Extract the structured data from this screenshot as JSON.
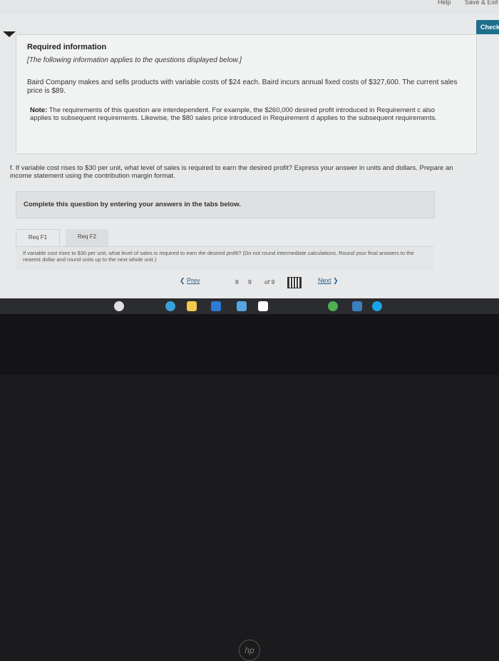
{
  "header": {
    "help": "Help",
    "save_exit": "Save & Exit",
    "check": "Check"
  },
  "required": {
    "title": "Required information",
    "subtitle": "[The following information applies to the questions displayed below.]",
    "body": "Baird Company makes and sells products with variable costs of $24 each. Baird incurs annual fixed costs of $327,600. The current sales price is $89.",
    "note_label": "Note:",
    "note": " The requirements of this question are interdependent. For example, the $260,000 desired profit introduced in Requirement c also applies to subsequent requirements. Likewise, the $80 sales price introduced in Requirement d applies to the subsequent requirements."
  },
  "question": "f. If variable cost rises to $30 per unit, what level of sales is required to earn the desired profit? Express your answer in units and dollars. Prepare an income statement using the contribution margin format.",
  "complete": "Complete this question by entering your answers in the tabs below.",
  "tabs": [
    {
      "label": "Req F1"
    },
    {
      "label": "Req F2"
    }
  ],
  "tab_instruction": "If variable cost rises to $30 per unit, what level of sales is required to earn the desired profit? (Do not round intermediate calculations. Round your final answers to the nearest dollar and round units up to the next whole unit.)",
  "pager": {
    "prev": "Prev",
    "pages": [
      "8",
      "9"
    ],
    "of": "of 9",
    "next": "Next"
  },
  "bezel": {
    "logo": "hp"
  }
}
